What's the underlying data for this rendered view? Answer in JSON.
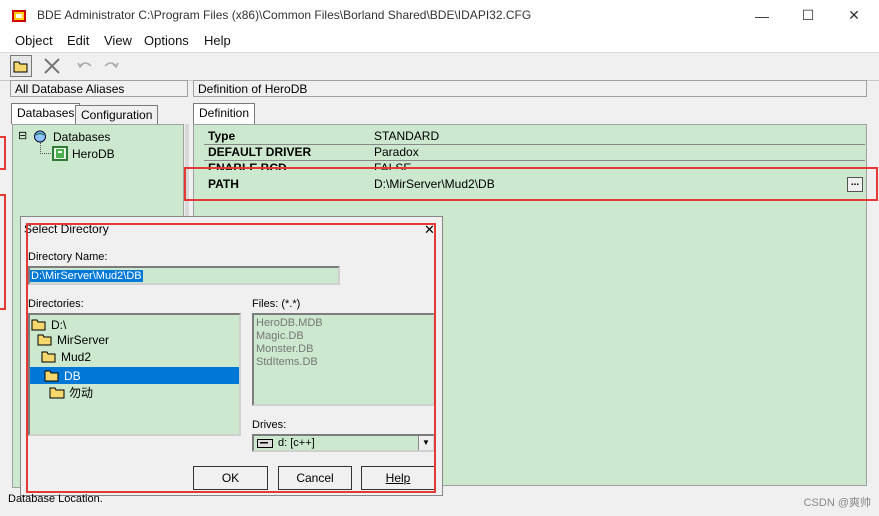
{
  "window": {
    "title": "BDE Administrator  C:\\Program Files (x86)\\Common Files\\Borland Shared\\BDE\\IDAPI32.CFG",
    "minimize_glyph": "—",
    "maximize_glyph": "☐",
    "close_glyph": "✕"
  },
  "menu": [
    "Object",
    "Edit",
    "View",
    "Options",
    "Help"
  ],
  "toolbar": {
    "icons": [
      "open-folder-icon",
      "delete-x-icon",
      "undo-icon",
      "redo-icon"
    ]
  },
  "left_panel": {
    "header": "All Database Aliases",
    "tabs": [
      "Databases",
      "Configuration"
    ],
    "active_tab": "Databases",
    "tree": {
      "root": "Databases",
      "expander": "⊟",
      "child": "HeroDB"
    }
  },
  "right_panel": {
    "header": "Definition of HeroDB",
    "tab": "Definition",
    "rows": [
      {
        "key": "Type",
        "value": "STANDARD"
      },
      {
        "key": "DEFAULT DRIVER",
        "value": "Paradox"
      },
      {
        "key": "ENABLE BCD",
        "value": "FALSE"
      },
      {
        "key": "PATH",
        "value": "D:\\MirServer\\Mud2\\DB"
      }
    ],
    "browse_button": "..."
  },
  "dialog": {
    "title": "Select Directory",
    "close_glyph": "✕",
    "directory_name_label": "Directory Name:",
    "directory_name_value": "D:\\MirServer\\Mud2\\DB",
    "directories_label": "Directories:",
    "directories": [
      {
        "name": "D:\\",
        "indent": 0
      },
      {
        "name": "MirServer",
        "indent": 1
      },
      {
        "name": "Mud2",
        "indent": 2
      },
      {
        "name": "DB",
        "indent": 3,
        "selected": true
      },
      {
        "name": "勿动",
        "indent": 4
      }
    ],
    "files_label": "Files: (*.*)",
    "files": [
      "HeroDB.MDB",
      "Magic.DB",
      "Monster.DB",
      "StdItems.DB"
    ],
    "drives_label": "Drives:",
    "drive_value": "d: [c++]",
    "buttons": {
      "ok": "OK",
      "cancel": "Cancel",
      "help": "Help"
    }
  },
  "status_text": "Database Location.",
  "watermark": "CSDN @爽帅",
  "colors": {
    "panel_green": "#cce8cf",
    "selection_blue": "#0078d7",
    "highlight_red": "#e53935",
    "folder_yellow": "#f5d76e"
  }
}
